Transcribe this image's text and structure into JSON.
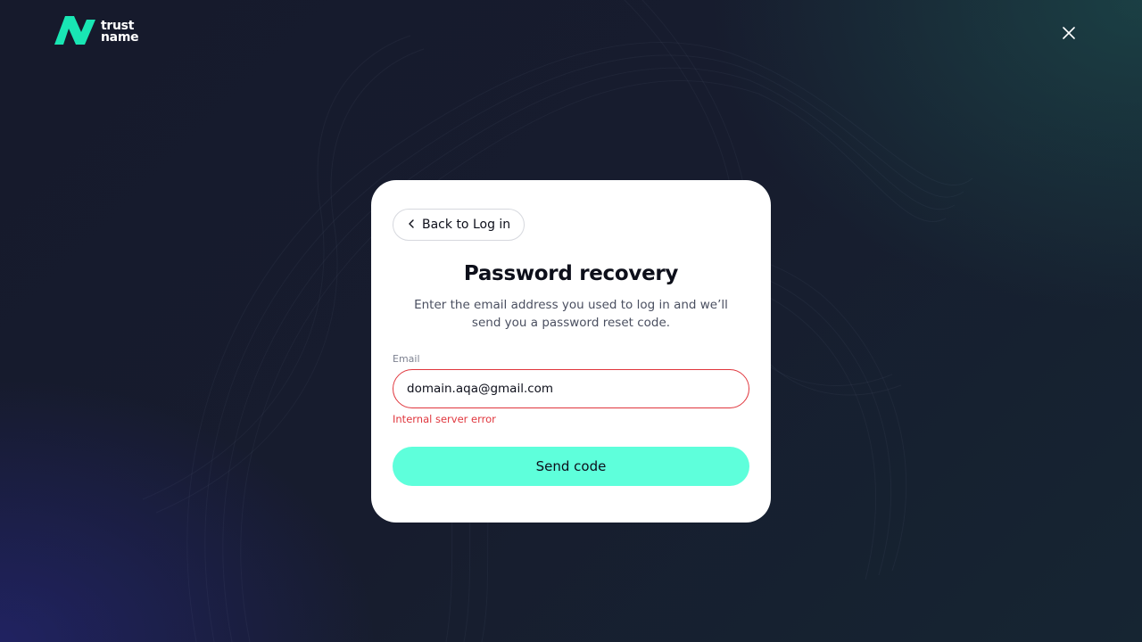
{
  "brand": {
    "line1": "trust",
    "line2": "name",
    "accent_color": "#19e6b4"
  },
  "dialog": {
    "back_label": "Back to Log in",
    "title": "Password recovery",
    "subtitle": "Enter the email address you used to log in and we’ll send you a password reset code.",
    "email_label": "Email",
    "email_value": "domain.aqa@gmail.com",
    "error_text": "Internal server error",
    "send_label": "Send code"
  },
  "colors": {
    "button": "#5effdb",
    "error": "#e0363d"
  },
  "icons": {
    "close": "close-icon",
    "back": "chevron-left-icon",
    "logo": "trustname-logo-icon"
  }
}
